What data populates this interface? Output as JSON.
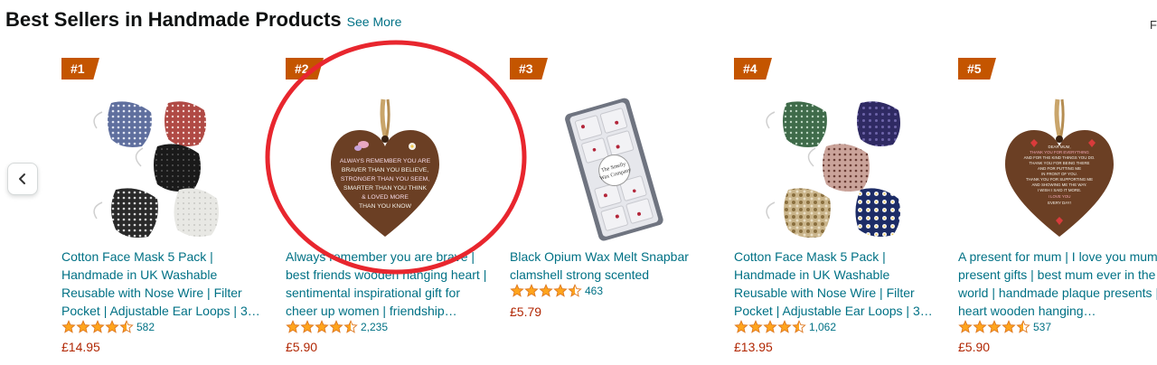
{
  "header": {
    "title": "Best Sellers in Handmade Products",
    "see_more": "See More",
    "edge_glyph": "F"
  },
  "carousel": {
    "prev_icon": "chevron-left-icon"
  },
  "products": [
    {
      "rank": "#1",
      "title": "Cotton Face Mask 5 Pack | Handmade in UK Washable Reusable with Nose Wire | Filter Pocket | Adjustable Ear Loops | 3…",
      "rating": 4.5,
      "reviews": "582",
      "price": "£14.95"
    },
    {
      "rank": "#2",
      "title": "Always remember you are brave | best friends wooden hanging heart | sentimental inspirational gift for cheer up women | friendship…",
      "rating": 4.5,
      "reviews": "2,235",
      "price": "£5.90",
      "image_text": [
        "ALWAYS REMEMBER YOU ARE",
        "BRAVER THAN YOU BELIEVE,",
        "STRONGER THAN YOU SEEM,",
        "SMARTER THAN YOU THINK",
        "& LOVED MORE",
        "THAN YOU KNOW"
      ]
    },
    {
      "rank": "#3",
      "title": "Black Opium Wax Melt Snapbar clamshell strong scented",
      "rating": 4.5,
      "reviews": "463",
      "price": "£5.79",
      "image_text": [
        "The Smelly",
        "Wax Company"
      ]
    },
    {
      "rank": "#4",
      "title": "Cotton Face Mask 5 Pack | Handmade in UK Washable Reusable with Nose Wire | Filter Pocket | Adjustable Ear Loops | 3…",
      "rating": 4.5,
      "reviews": "1,062",
      "price": "£13.95"
    },
    {
      "rank": "#5",
      "title": "A present for mum | I love you mum present gifts | best mum ever in the world | handmade plaque presents | heart wooden hanging…",
      "rating": 4.5,
      "reviews": "537",
      "price": "£5.90",
      "image_text": [
        "DEAR MUM,",
        "THANK YOU FOR EVERYTHING",
        "AND FOR THE KIND THINGS YOU DO.",
        "THANK YOU FOR BEING THERE",
        "AND FOR PUTTING ME",
        "IN FRONT OF YOU.",
        "THANK YOU FOR SUPPORTING ME",
        "AND SHOWING ME THE WAY.",
        "I WISH I SAID IT MORE.",
        "I LOVE YOU",
        "EVERY DAY!"
      ]
    }
  ],
  "colors": {
    "badge": "#c45500",
    "link": "#007185",
    "price": "#b12704",
    "star": "#ffa41c",
    "annotation": "#e8262e"
  }
}
